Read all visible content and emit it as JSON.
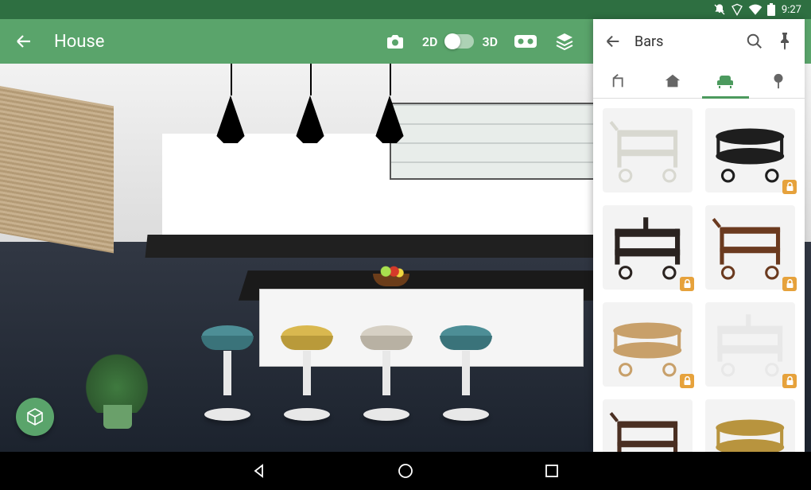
{
  "status": {
    "time": "9:27"
  },
  "appbar": {
    "title": "House",
    "mode_2d": "2D",
    "mode_3d": "3D"
  },
  "panel": {
    "title": "Bars",
    "tabs": [
      "room",
      "house",
      "furniture",
      "plant"
    ],
    "active_tab_index": 2,
    "items": [
      {
        "name": "white-bar-cart",
        "locked": false,
        "color": "#d8d8d0"
      },
      {
        "name": "black-oval-bar-cart",
        "locked": true,
        "color": "#1e1e1e"
      },
      {
        "name": "industrial-bar-cart",
        "locked": true,
        "color": "#2a2320"
      },
      {
        "name": "wood-wine-cart",
        "locked": true,
        "color": "#6b3a1f"
      },
      {
        "name": "teak-bar-cart",
        "locked": true,
        "color": "#c8a06a"
      },
      {
        "name": "white-lattice-cart",
        "locked": true,
        "color": "#e8e8e8"
      },
      {
        "name": "dark-stool",
        "locked": false,
        "color": "#4a2f22"
      },
      {
        "name": "brass-ring-cart",
        "locked": false,
        "color": "#b8943e"
      }
    ]
  }
}
